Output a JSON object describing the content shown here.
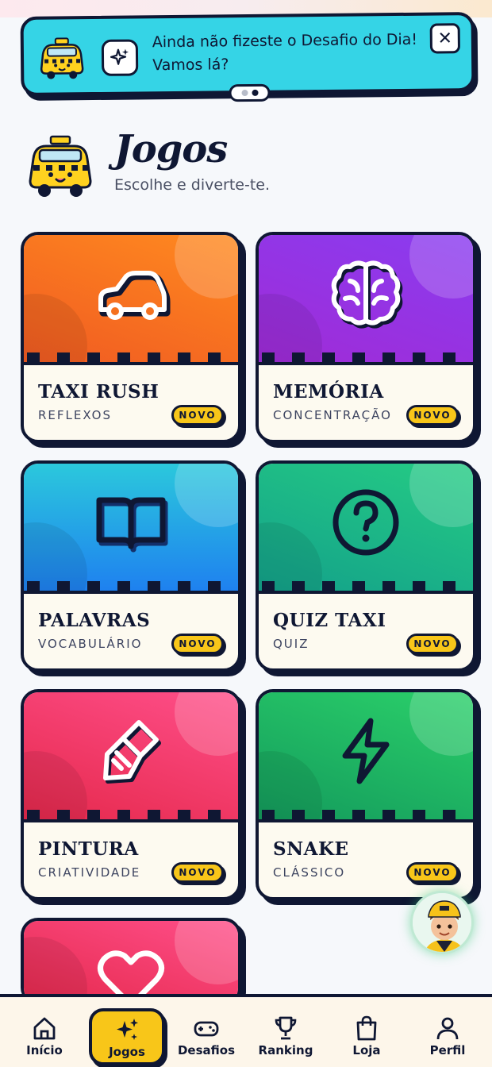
{
  "banner": {
    "message": "Ainda não fizeste o Desafio do Dia! Vamos lá?",
    "close_label": "✕",
    "pages_total": 2,
    "page_active": 2
  },
  "header": {
    "title": "Jogos",
    "subtitle": "Escolhe e diverte-te."
  },
  "badge_label": "NOVO",
  "games": [
    {
      "title": "TAXI RUSH",
      "category": "REFLEXOS",
      "icon": "car-icon",
      "color": "#f5711f"
    },
    {
      "title": "MEMÓRIA",
      "category": "CONCENTRAÇÃO",
      "icon": "brain-icon",
      "color": "#8f34e6"
    },
    {
      "title": "PALAVRAS",
      "category": "VOCABULÁRIO",
      "icon": "book-icon",
      "color": "#23a6e6"
    },
    {
      "title": "QUIZ TAXI",
      "category": "QUIZ",
      "icon": "question-icon",
      "color": "#1bb388"
    },
    {
      "title": "PINTURA",
      "category": "CRIATIVIDADE",
      "icon": "brush-icon",
      "color": "#f23d6a"
    },
    {
      "title": "SNAKE",
      "category": "CLÁSSICO",
      "icon": "bolt-icon",
      "color": "#20b663"
    },
    {
      "icon": "heart-icon",
      "color": "#f23d6a"
    }
  ],
  "nav": [
    {
      "label": "Início",
      "icon": "home-icon",
      "active": false
    },
    {
      "label": "Jogos",
      "icon": "sparkles-icon",
      "active": true
    },
    {
      "label": "Desafios",
      "icon": "gamepad-icon",
      "active": false
    },
    {
      "label": "Ranking",
      "icon": "trophy-icon",
      "active": false
    },
    {
      "label": "Loja",
      "icon": "shopping-bag-icon",
      "active": false
    },
    {
      "label": "Perfil",
      "icon": "user-icon",
      "active": false
    }
  ]
}
